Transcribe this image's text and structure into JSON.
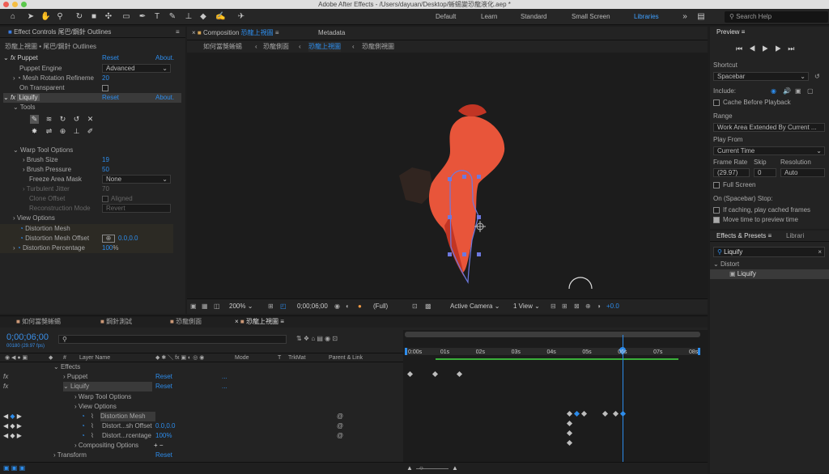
{
  "app": {
    "title": "Adobe After Effects - /Users/dayuan/Desktop/蜥蜴變恐龍液化.aep *"
  },
  "toolbar": {
    "icons": [
      "home-icon",
      "selection-arrow-icon",
      "hand-icon",
      "zoom-icon",
      "rotate-icon",
      "camera-icon",
      "pan-behind-icon",
      "rectangle-icon",
      "pen-icon",
      "type-icon",
      "brush-icon",
      "clone-stamp-icon",
      "eraser-icon",
      "roto-brush-icon",
      "puppet-pin-icon"
    ],
    "workspaces": {
      "default": "Default",
      "learn": "Learn",
      "standard": "Standard",
      "small_screen": "Small Screen",
      "libraries": "Libraries"
    },
    "search_placeholder": "Search Help"
  },
  "effect_controls": {
    "tab": "Effect Controls 尾巴/鋼針 Outlines",
    "layer": "恐龍上視圖 • 尾巴/鋼針 Outlines",
    "puppet": {
      "name": "Puppet",
      "reset": "Reset",
      "about": "About.",
      "engine_label": "Puppet Engine",
      "engine": "Advanced",
      "mesh_label": "Mesh Rotation Refineme",
      "mesh_value": "20",
      "transparent_label": "On Transparent"
    },
    "liquify": {
      "name": "Liquify",
      "reset": "Reset",
      "about": "About.",
      "tools_label": "Tools",
      "warp_label": "Warp Tool Options",
      "brush_size_label": "Brush Size",
      "brush_size": "19",
      "brush_pressure_label": "Brush Pressure",
      "brush_pressure": "50",
      "freeze_label": "Freeze Area Mask",
      "freeze": "None",
      "turbulent_label": "Turbulent Jitter",
      "turbulent": "70",
      "clone_label": "Clone Offset",
      "clone_aligned": "Aligned",
      "recon_label": "Reconstruction Mode",
      "recon": "Revert",
      "view_label": "View Options",
      "mesh": "Distortion Mesh",
      "mesh_offset_label": "Distortion Mesh Offset",
      "mesh_offset": "0.0,0.0",
      "pct_label": "Distortion Percentage",
      "pct": "100",
      "pct_unit": "%"
    }
  },
  "composition": {
    "tab": "Composition",
    "tab_name": "恐龍上視圖",
    "metadata": "Metadata",
    "breadcrumbs": [
      "如何當獎蜥蜴",
      "恐龍側面",
      "恐龍上視圖",
      "恐龍側視圖"
    ],
    "zoom": "200%",
    "timecode": "0;00;06;00",
    "quality": "(Full)",
    "camera": "Active Camera",
    "views": "1 View",
    "exposure": "+0.0"
  },
  "preview": {
    "title": "Preview",
    "shortcut_label": "Shortcut",
    "shortcut": "Spacebar",
    "include_label": "Include:",
    "cache_label": "Cache Before Playback",
    "range_label": "Range",
    "range": "Work Area Extended By Current ...",
    "play_from_label": "Play From",
    "play_from": "Current Time",
    "frame_rate_label": "Frame Rate",
    "skip_label": "Skip",
    "resolution_label": "Resolution",
    "frame_rate": "(29.97)",
    "skip": "0",
    "resolution": "Auto",
    "fullscreen_label": "Full Screen",
    "stop_label": "On (Spacebar) Stop:",
    "if_caching": "If caching, play cached frames",
    "move_time": "Move time to preview time"
  },
  "effects_presets": {
    "tab": "Effects & Presets",
    "libraries_tab": "Librari",
    "search": "Liquify",
    "category": "Distort",
    "item": "Liquify"
  },
  "timeline": {
    "tabs": [
      "如何當獎蜥蜴",
      "鋼針測試",
      "恐龍側面",
      "恐龍上視圖"
    ],
    "timecode": "0;00;06;00",
    "fps": "00180 (29.97 fps)",
    "cols": {
      "layer_name": "Layer Name",
      "mode": "Mode",
      "t": "T",
      "trkmat": "TrkMat",
      "parent": "Parent & Link"
    },
    "rows": [
      {
        "name": "Effects",
        "level": 0
      },
      {
        "name": "Puppet",
        "level": 1,
        "fx": true,
        "reset": "Reset",
        "more": "..."
      },
      {
        "name": "Liquify",
        "level": 1,
        "fx": true,
        "reset": "Reset",
        "more": "..."
      },
      {
        "name": "Warp Tool Options",
        "level": 2
      },
      {
        "name": "View Options",
        "level": 2
      },
      {
        "name": "Distortion Mesh",
        "level": 3
      },
      {
        "name": "Distort...sh Offset",
        "level": 3,
        "value": "0.0,0.0"
      },
      {
        "name": "Distort...rcentage",
        "level": 3,
        "value": "100%"
      },
      {
        "name": "Compositing Options",
        "level": 2,
        "value": "+ −"
      },
      {
        "name": "Transform",
        "level": 0,
        "reset": "Reset"
      }
    ],
    "ruler": [
      "0:00s",
      "01s",
      "02s",
      "03s",
      "04s",
      "05s",
      "06s",
      "07s",
      "08s"
    ],
    "playhead_seconds": 6.0,
    "duration_seconds": 8.0,
    "keyframes": [
      {
        "row": 1,
        "times": [
          0.0,
          0.7,
          1.4
        ]
      },
      {
        "row": 5,
        "times": [
          4.5,
          4.7,
          4.9,
          5.5,
          5.8,
          6.0
        ]
      },
      {
        "row": 6,
        "times": [
          4.5
        ]
      },
      {
        "row": 7,
        "times": [
          4.5
        ]
      },
      {
        "row": 8,
        "times": [
          4.5
        ]
      }
    ]
  }
}
